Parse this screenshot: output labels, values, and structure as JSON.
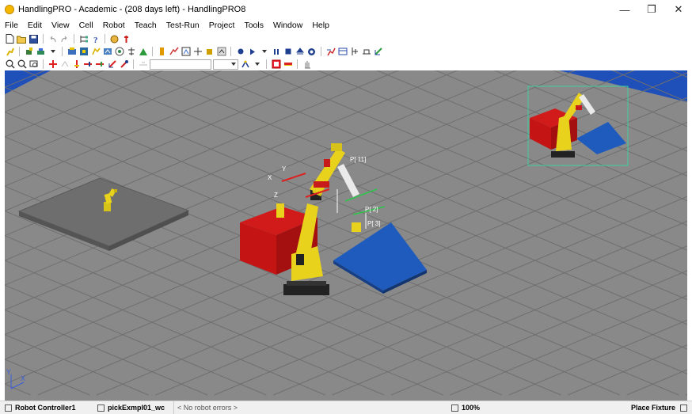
{
  "window": {
    "title": "HandlingPRO - Academic - (208 days left) - HandlingPRO8",
    "minimize_glyph": "—",
    "maximize_glyph": "❐",
    "close_glyph": "✕"
  },
  "menu": [
    "File",
    "Edit",
    "View",
    "Cell",
    "Robot",
    "Teach",
    "Test-Run",
    "Project",
    "Tools",
    "Window",
    "Help"
  ],
  "toolbar": {
    "row1": [
      "new-document-icon",
      "open-folder-icon",
      "save-icon",
      "undo-icon",
      "redo-icon",
      "tree-icon",
      "info-icon",
      "hand-icon",
      "pin-icon"
    ],
    "row2": [
      "robot-add-icon",
      "part-add-icon",
      "fixture-add-icon",
      "dropdown-arrow-icon",
      "obstacle-icon",
      "target-icon",
      "camera-icon",
      "path-icon",
      "machine-icon",
      "teach-pendant-icon",
      "move-icon",
      "run-icon",
      "program-icon",
      "frame-icon",
      "grid-icon",
      "play-icon",
      "play-step-icon",
      "pause-icon",
      "stop-icon",
      "eject-icon",
      "abort-icon",
      "chart-icon",
      "calculator-icon",
      "io-icon",
      "weld-icon",
      "conveyor-icon"
    ],
    "row3": [
      "zoom-in-icon",
      "zoom-out-icon",
      "zoom-window-icon",
      "pan-icon",
      "rotate-icon",
      "view-top-icon",
      "view-front-icon",
      "view-side-icon",
      "view-iso-icon",
      "view-custom-icon"
    ],
    "view_combo": "",
    "row3_extra": [
      "frame-select-icon",
      "record-icon",
      "measure-icon",
      "hand-tool-icon"
    ]
  },
  "viewport": {
    "background": "#8a8a8a",
    "floor_line_color": "#6f6f6f",
    "accent_blue": "#1f4fb8",
    "robot_yellow": "#e8d21c",
    "box_red": "#c41414",
    "fixture_blue": "#1e5bbd",
    "labels": [
      "P[ 11]",
      "P[ 2]",
      "P[ 3]",
      "X",
      "Y",
      "Z"
    ],
    "triad_labels": [
      "X",
      "Y"
    ]
  },
  "statusbar": {
    "controller": "Robot Controller1",
    "program": "pickExmpl01_wc",
    "errors": "< No robot errors >",
    "zoom": "100%",
    "mode": "Place Fixture"
  }
}
